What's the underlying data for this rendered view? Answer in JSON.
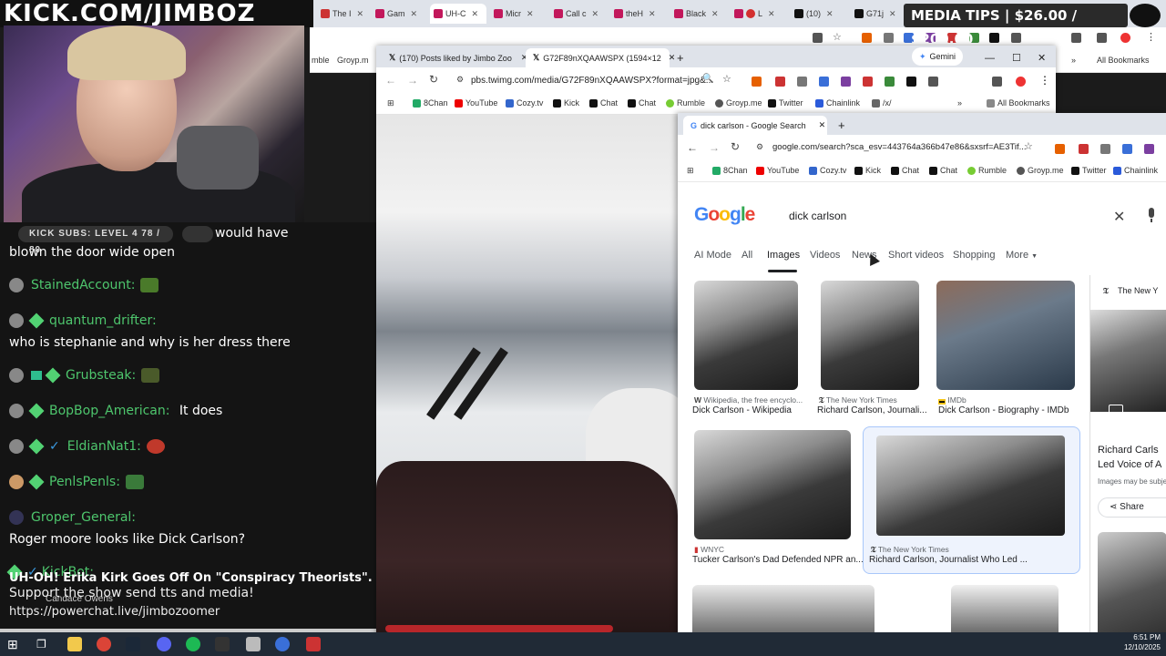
{
  "stream": {
    "kick_url": "KICK.COM/JIMBOZ",
    "media_tips": "MEDIA TIPS | $26.00 / $200.00",
    "subs_label": "KICK SUBS: LEVEL 4 78 / 80",
    "ticker": "UH-OH! Erika Kirk Goes Off On \"Conspiracy Theorists\". | Candace E",
    "ticker_sub": "Candace Owens",
    "support": "Support the show send tts and media!",
    "powerchat": "https://powerchat.live/jimbozoomer"
  },
  "chat": [
    {
      "user": "",
      "text": "would have",
      "cont": "blown the door wide open"
    },
    {
      "user": "StainedAccount:",
      "text": ""
    },
    {
      "user": "quantum_drifter:",
      "text": "who is stephanie and why is her dress there"
    },
    {
      "user": "Grubsteak:",
      "text": ""
    },
    {
      "user": "BopBop_American:",
      "text": "It does"
    },
    {
      "user": "EldianNat1:",
      "text": ""
    },
    {
      "user": "PenlsPenls:",
      "text": ""
    },
    {
      "user": "Groper_General:",
      "text": "Roger moore looks like Dick Carlson?"
    },
    {
      "user": "KickBot:",
      "text": ""
    }
  ],
  "bg_browser": {
    "tabs": [
      "The I",
      "Gam",
      "UH-C",
      "Micr",
      "Call c",
      "theH",
      "Black",
      "L",
      "(10)",
      "G71j"
    ],
    "bookmark_left": "mble",
    "bookmark_groyp": "Groyp.m",
    "all_bookmarks": "All Bookmarks",
    "update": "date"
  },
  "mid_browser": {
    "tabs": [
      "(170) Posts liked by Jimbo Zoo",
      "G72F89nXQAAWSPX (1594×12"
    ],
    "url": "pbs.twimg.com/media/G72F89nXQAAWSPX?format=jpg&...",
    "gemini": "Gemini",
    "bookmarks": [
      "8Chan",
      "YouTube",
      "Cozy.tv",
      "Kick",
      "Chat",
      "Chat",
      "Rumble",
      "Groyp.me",
      "Twitter",
      "Chainlink",
      "/x/"
    ],
    "all_bookmarks": "All Bookmarks"
  },
  "google": {
    "tab_title": "dick carlson - Google Search",
    "url": "google.com/search?sca_esv=443764a366b47e86&sxsrf=AE3Tif...",
    "bookmarks": [
      "8Chan",
      "YouTube",
      "Cozy.tv",
      "Kick",
      "Chat",
      "Chat",
      "Rumble",
      "Groyp.me",
      "Twitter",
      "Chainlink"
    ],
    "logo": "Google",
    "query": "dick carlson",
    "tabs": [
      "AI Mode",
      "All",
      "Images",
      "Videos",
      "News",
      "Short videos",
      "Shopping",
      "More"
    ],
    "results": [
      {
        "source": "Wikipedia, the free encyclo...",
        "caption": "Dick Carlson - Wikipedia"
      },
      {
        "source": "The New York Times",
        "caption": "Richard Carlson, Journali..."
      },
      {
        "source": "IMDb",
        "caption": "Dick Carlson - Biography - IMDb"
      },
      {
        "source": "WNYC",
        "caption": "Tucker Carlson's Dad Defended NPR an..."
      },
      {
        "source": "The New York Times",
        "caption": "Richard Carlson, Journalist Who Led ..."
      }
    ],
    "side": {
      "source": "The New Y",
      "title1": "Richard Carls",
      "title2": "Led Voice of A",
      "note": "Images may be subje",
      "share": "Share"
    }
  },
  "taskbar": {
    "time": "6:51 PM",
    "date": "12/10/2025"
  }
}
